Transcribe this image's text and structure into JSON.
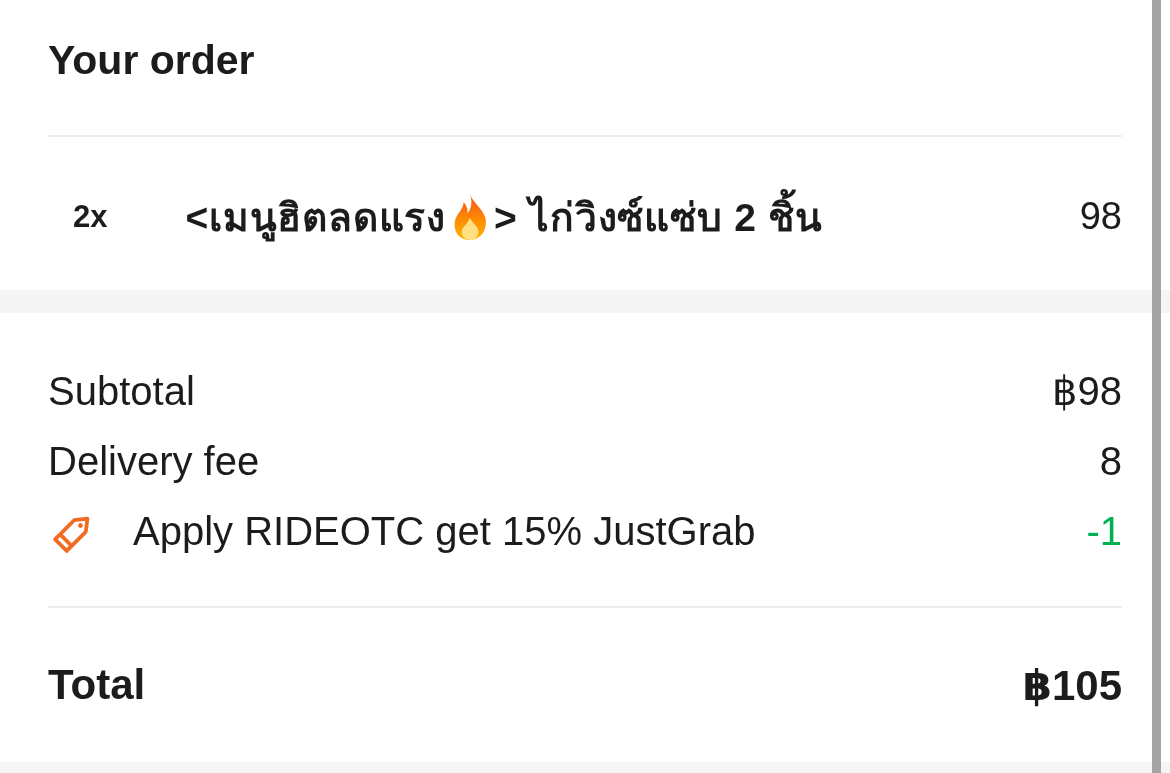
{
  "order": {
    "title": "Your order",
    "items": [
      {
        "quantity": "2x",
        "name_before_icon": "<เมนูฮิตลดแรง",
        "name_after_icon": "> ไก่วิงซ์แซ่บ 2 ชิ้น",
        "price": "98"
      }
    ]
  },
  "summary": {
    "lines": [
      {
        "kind": "plain",
        "label": "Subtotal",
        "amount": "฿98"
      },
      {
        "kind": "plain",
        "label": "Delivery fee",
        "amount": "8"
      },
      {
        "kind": "promo",
        "label": "Apply RIDEOTC get 15% JustGrab",
        "amount": "-1"
      }
    ],
    "total": {
      "label": "Total",
      "amount": "฿105"
    }
  }
}
